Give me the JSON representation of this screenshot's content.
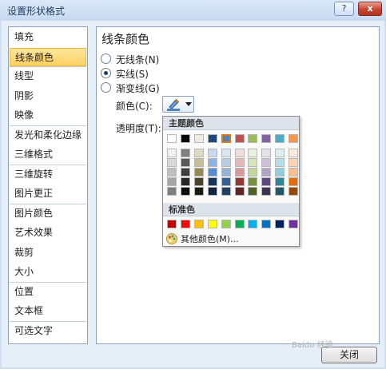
{
  "window": {
    "title": "设置形状格式",
    "help_label": "?",
    "close_label": "x"
  },
  "nav": {
    "items": [
      "填充",
      "线条颜色",
      "线型",
      "阴影",
      "映像",
      "发光和柔化边缘",
      "三维格式",
      "三维旋转",
      "图片更正",
      "图片颜色",
      "艺术效果",
      "裁剪",
      "大小",
      "位置",
      "文本框",
      "可选文字"
    ],
    "selected_index": 1
  },
  "panel": {
    "title": "线条颜色",
    "options": [
      {
        "label": "无线条(N)",
        "checked": false
      },
      {
        "label": "实线(S)",
        "checked": true
      },
      {
        "label": "渐变线(G)",
        "checked": false
      }
    ],
    "color_label": "颜色(C):",
    "transparency_label": "透明度(T):"
  },
  "dropdown": {
    "theme_header": "主题颜色",
    "standard_header": "标准色",
    "more_label": "其他颜色(M)...",
    "theme_colors": [
      [
        "#ffffff",
        "#000000",
        "#eeece1",
        "#1f497d",
        "#4f81bd",
        "#c0504d",
        "#9bbb59",
        "#8064a2",
        "#4bacc6",
        "#f79646"
      ],
      [
        "#f2f2f2",
        "#7f7f7f",
        "#ddd9c3",
        "#c6d9f0",
        "#dbe5f1",
        "#f2dcdb",
        "#ebf1dd",
        "#e5e0ec",
        "#dbeef3",
        "#fdeada"
      ],
      [
        "#d8d8d8",
        "#595959",
        "#c4bd97",
        "#8db3e2",
        "#b8cce4",
        "#e5b9b7",
        "#d7e3bc",
        "#ccc1d9",
        "#b7dde8",
        "#fbd5b5"
      ],
      [
        "#bfbfbf",
        "#3f3f3f",
        "#938953",
        "#548dd4",
        "#95b3d7",
        "#d99694",
        "#c3d69b",
        "#b2a2c7",
        "#92cddc",
        "#fac08f"
      ],
      [
        "#a5a5a5",
        "#262626",
        "#494429",
        "#17365d",
        "#366092",
        "#953734",
        "#76923c",
        "#5f497a",
        "#31859b",
        "#e36c09"
      ],
      [
        "#7f7f7f",
        "#0c0c0c",
        "#1d1b10",
        "#0f243e",
        "#244061",
        "#632423",
        "#4f6128",
        "#3f3151",
        "#205867",
        "#974806"
      ]
    ],
    "selected_theme": [
      0,
      4
    ],
    "standard_colors": [
      "#c00000",
      "#ff0000",
      "#ffc000",
      "#ffff00",
      "#92d050",
      "#00b050",
      "#00b0f0",
      "#0070c0",
      "#002060",
      "#7030a0"
    ]
  },
  "footer": {
    "close_label": "关闭",
    "watermark": "Baidu 经验"
  }
}
